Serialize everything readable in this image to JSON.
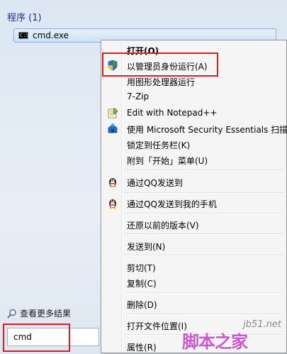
{
  "start_panel": {
    "section_title": "程序 (1)",
    "program_item": {
      "label": "cmd.exe",
      "icon": "cmd-icon"
    },
    "see_more": "查看更多结果",
    "search": {
      "value": "cmd"
    }
  },
  "context_menu": {
    "items": [
      {
        "label": "打开(O)",
        "bold": true
      },
      {
        "label": "以管理员身份运行(A)",
        "icon": "uac-shield-icon"
      },
      {
        "label": "用图形处理器运行"
      },
      {
        "label": "7-Zip"
      },
      {
        "label": "Edit with Notepad++",
        "icon": "notepad-plus-plus-icon"
      },
      {
        "label": "使用 Microsoft Security Essentials 扫描...",
        "icon": "security-essentials-icon"
      },
      {
        "label": "锁定到任务栏(K)"
      },
      {
        "label": "附到「开始」菜单(U)"
      },
      {
        "label": "通过QQ发送到",
        "icon": "qq-penguin-icon"
      },
      {
        "label": "通过QQ发送到我的手机",
        "icon": "qq-penguin-icon"
      },
      {
        "label": "还原以前的版本(V)"
      },
      {
        "label": "发送到(N)"
      },
      {
        "label": "剪切(T)"
      },
      {
        "label": "复制(C)"
      },
      {
        "label": "删除(D)"
      },
      {
        "label": "打开文件位置(I)"
      },
      {
        "label": "属性(R)"
      }
    ]
  },
  "watermark": {
    "site": "jb51.net",
    "text": "脚本之家"
  },
  "colors": {
    "highlight_frame": "#e11b1b",
    "header_blue": "#1e3287"
  }
}
